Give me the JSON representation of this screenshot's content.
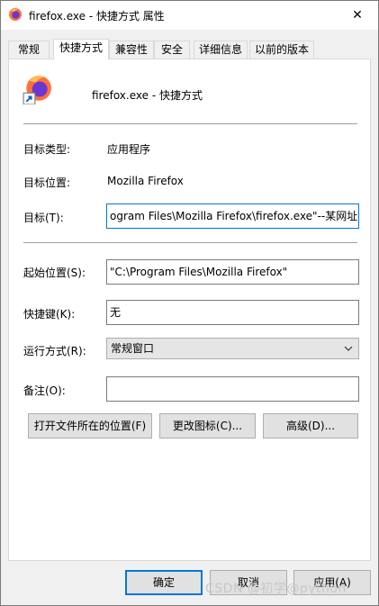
{
  "window": {
    "title": "firefox.exe - 快捷方式 属性",
    "close_glyph": "✕"
  },
  "tabs": [
    {
      "label": "常规"
    },
    {
      "label": "快捷方式"
    },
    {
      "label": "兼容性"
    },
    {
      "label": "安全"
    },
    {
      "label": "详细信息"
    },
    {
      "label": "以前的版本"
    }
  ],
  "active_tab": "快捷方式",
  "header": {
    "icon": "firefox-shortcut-icon",
    "name": "firefox.exe - 快捷方式"
  },
  "fields": {
    "target_type_label": "目标类型:",
    "target_type_value": "应用程序",
    "target_location_label": "目标位置:",
    "target_location_value": "Mozilla Firefox",
    "target_label": "目标(T):",
    "target_value": "ogram Files\\Mozilla Firefox\\firefox.exe\"--某网址",
    "start_in_label": "起始位置(S):",
    "start_in_value": "\"C:\\Program Files\\Mozilla Firefox\"",
    "hotkey_label": "快捷键(K):",
    "hotkey_value": "无",
    "run_label": "运行方式(R):",
    "run_value": "常规窗口",
    "comment_label": "备注(O):",
    "comment_value": ""
  },
  "buttons": {
    "open_location": "打开文件所在的位置(F)",
    "change_icon": "更改图标(C)...",
    "advanced": "高级(D)...",
    "ok": "确定",
    "cancel": "取消",
    "apply": "应用(A)"
  },
  "watermark": "CSDN @初学@python",
  "colors": {
    "accent": "#0078d7",
    "panel_bg": "#ffffff",
    "window_bg": "#f0f0f0"
  }
}
